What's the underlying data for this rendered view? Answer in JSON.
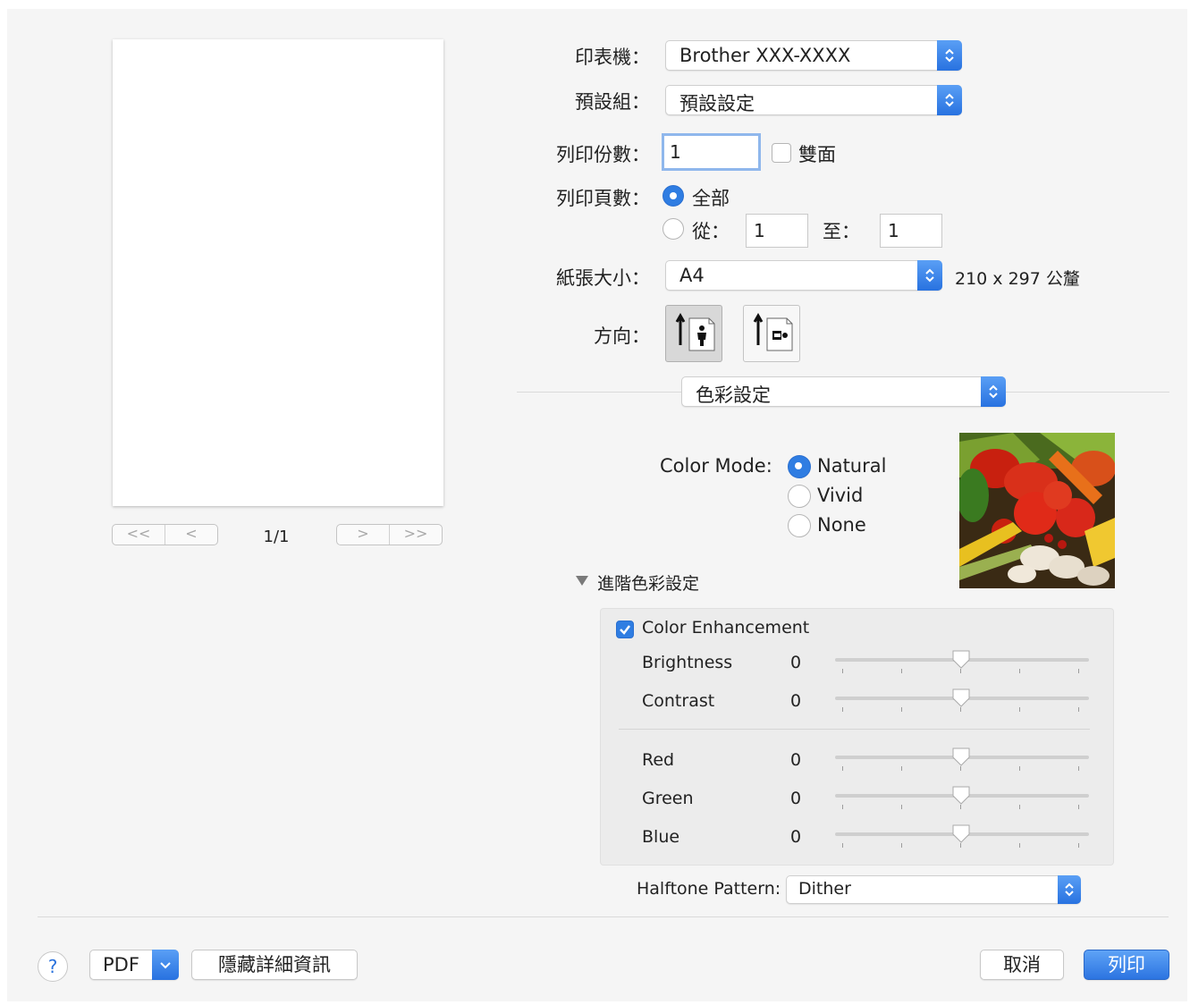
{
  "printer": {
    "label": "印表機：",
    "value": "Brother XXX-XXXX"
  },
  "presets": {
    "label": "預設組：",
    "value": "預設設定"
  },
  "copies": {
    "label": "列印份數：",
    "value": "1",
    "two_sided": "雙面"
  },
  "pages": {
    "label": "列印頁數：",
    "all": "全部",
    "from": "從：",
    "from_value": "1",
    "to": "至：",
    "to_value": "1",
    "selected": "all"
  },
  "paper": {
    "label": "紙張大小：",
    "value": "A4",
    "dims": "210 x 297 公釐"
  },
  "orientation": {
    "label": "方向：",
    "selected": "portrait"
  },
  "section": {
    "value": "色彩設定"
  },
  "color_mode": {
    "label": "Color Mode:",
    "options": [
      "Natural",
      "Vivid",
      "None"
    ],
    "selected": "Natural"
  },
  "advanced": {
    "label": "進階色彩設定",
    "expanded": true,
    "enhancement_label": "Color Enhancement",
    "enhancement_checked": true,
    "sliders": [
      {
        "name": "Brightness",
        "value": "0"
      },
      {
        "name": "Contrast",
        "value": "0"
      },
      {
        "name": "Red",
        "value": "0"
      },
      {
        "name": "Green",
        "value": "0"
      },
      {
        "name": "Blue",
        "value": "0"
      }
    ]
  },
  "halftone": {
    "label": "Halftone Pattern:",
    "value": "Dither"
  },
  "preview": {
    "page_count": "1/1"
  },
  "footer": {
    "help": "?",
    "pdf": "PDF",
    "hide_details": "隱藏詳細資訊",
    "cancel": "取消",
    "print": "列印"
  },
  "colors": {
    "accent": "#2f7de2",
    "background": "#f5f5f5"
  }
}
